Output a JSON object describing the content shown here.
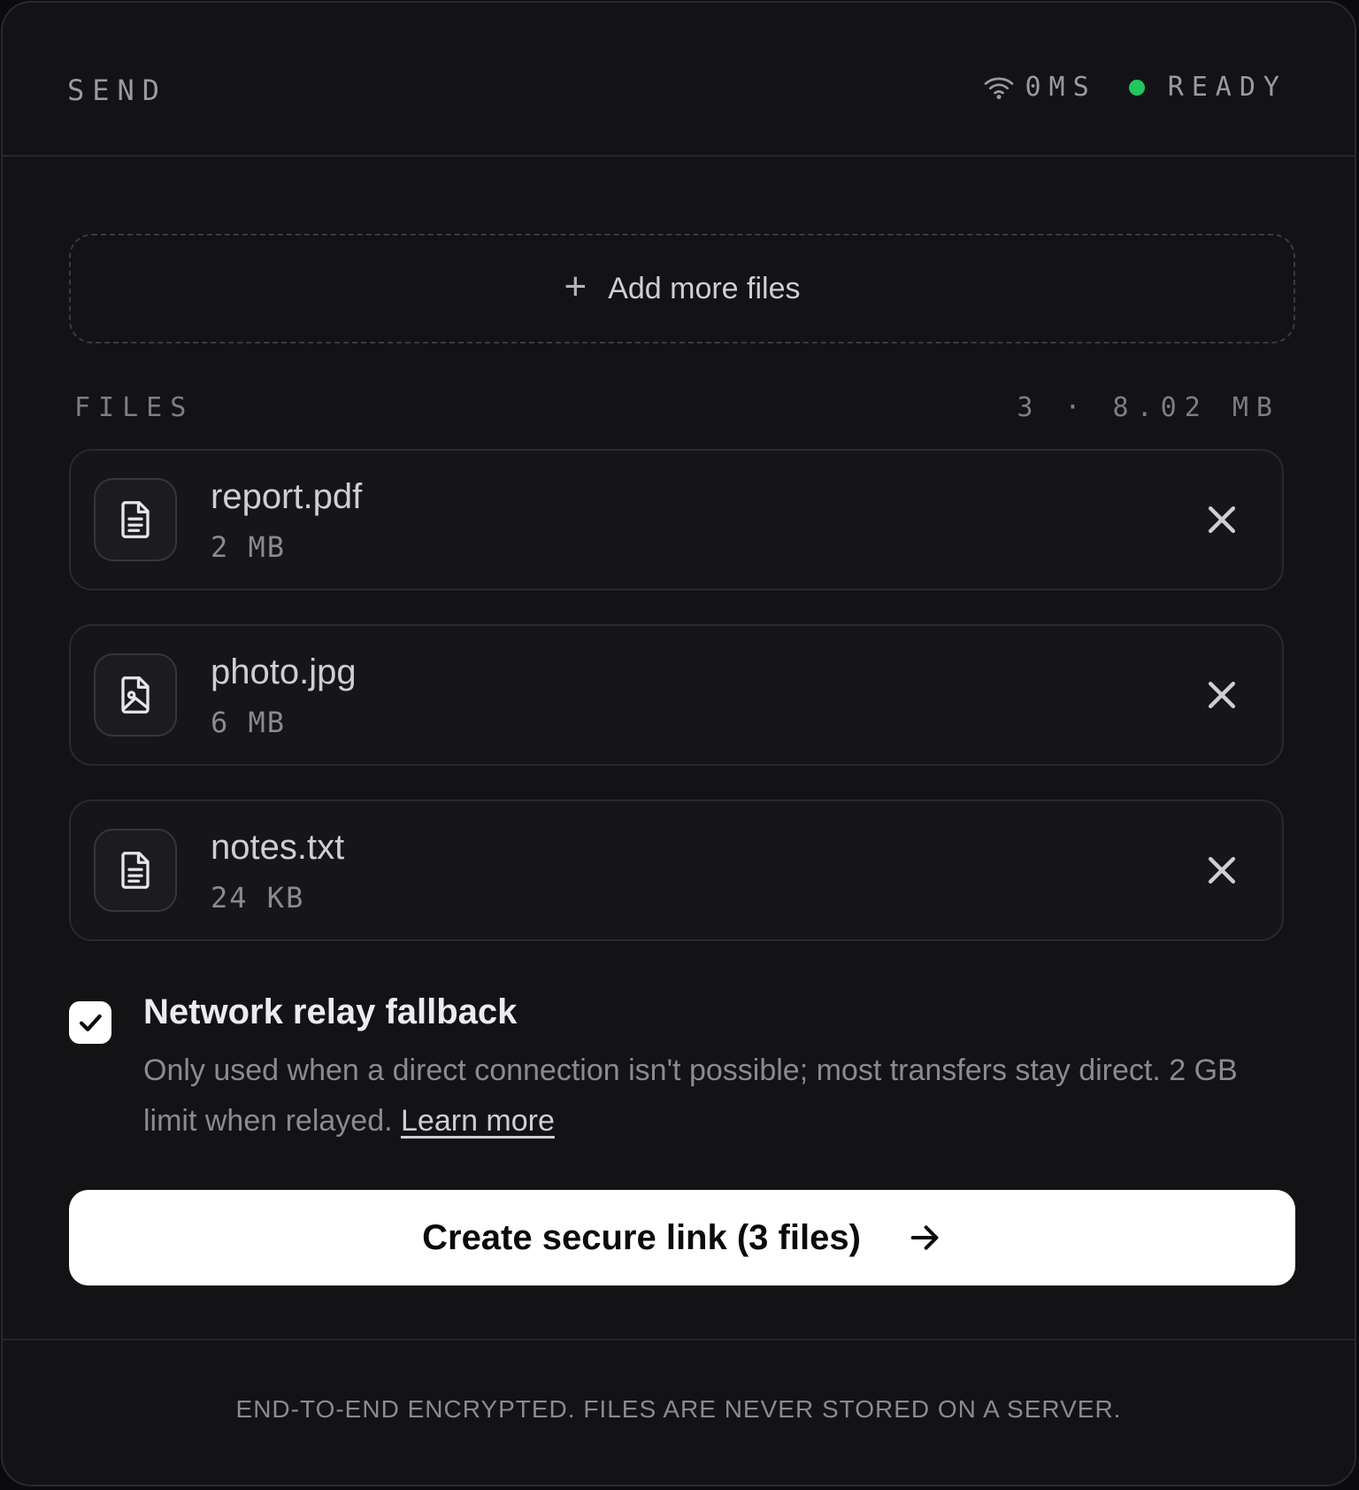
{
  "header": {
    "title": "SEND",
    "latency": "0MS",
    "status": "READY",
    "status_color": "#22c55e"
  },
  "dropzone": {
    "label": "Add more files",
    "icon": "plus-icon"
  },
  "files": {
    "section_label": "FILES",
    "summary": "3 · 8.02 MB",
    "items": [
      {
        "name": "report.pdf",
        "size": "2 MB",
        "icon": "document-icon"
      },
      {
        "name": "photo.jpg",
        "size": "6 MB",
        "icon": "image-file-icon"
      },
      {
        "name": "notes.txt",
        "size": "24 KB",
        "icon": "document-icon"
      }
    ]
  },
  "relay": {
    "checked": true,
    "title": "Network relay fallback",
    "description": "Only used when a direct connection isn't possible; most transfers stay direct. 2 GB limit when relayed.",
    "learn_more": "Learn more"
  },
  "cta": {
    "label": "Create secure link (3 files)",
    "icon": "arrow-right-icon"
  },
  "footer": {
    "text": "END-TO-END ENCRYPTED. FILES ARE NEVER STORED ON A SERVER."
  },
  "colors": {
    "background": "#131316",
    "border": "#2a2a2e",
    "accent_button": "#ffffff"
  }
}
